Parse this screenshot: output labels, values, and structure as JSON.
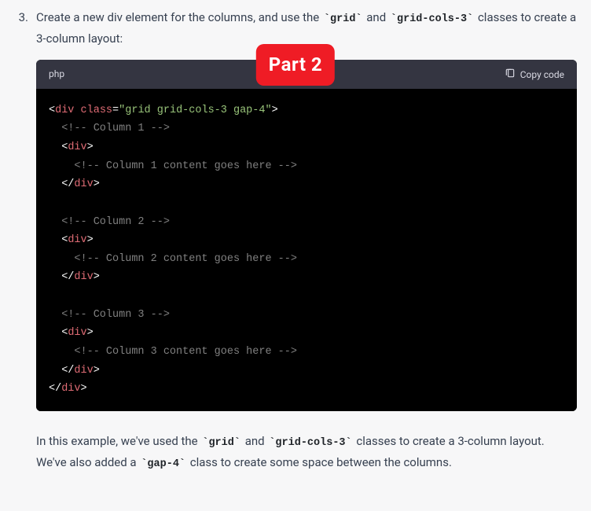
{
  "badge": "Part 2",
  "list": {
    "number": "3.",
    "text_a": "Create a new div element for the columns, and use the ",
    "code_a": "`grid`",
    "text_b": " and ",
    "code_b": "`grid-cols-3`",
    "text_c": " classes to create a 3-column layout:"
  },
  "code": {
    "lang": "php",
    "copy": "Copy code",
    "lines": [
      [
        {
          "cls": "tok-white",
          "t": "<"
        },
        {
          "cls": "tok-red",
          "t": "div"
        },
        {
          "cls": "tok-white",
          "t": " "
        },
        {
          "cls": "tok-red",
          "t": "class"
        },
        {
          "cls": "tok-white",
          "t": "="
        },
        {
          "cls": "tok-green",
          "t": "\"grid grid-cols-3 gap-4\""
        },
        {
          "cls": "tok-white",
          "t": ">"
        }
      ],
      [
        {
          "cls": "tok-white",
          "t": "  "
        },
        {
          "cls": "tok-comment",
          "t": "<!-- Column 1 -->"
        }
      ],
      [
        {
          "cls": "tok-white",
          "t": "  <"
        },
        {
          "cls": "tok-red",
          "t": "div"
        },
        {
          "cls": "tok-white",
          "t": ">"
        }
      ],
      [
        {
          "cls": "tok-white",
          "t": "    "
        },
        {
          "cls": "tok-comment",
          "t": "<!-- Column 1 content goes here -->"
        }
      ],
      [
        {
          "cls": "tok-white",
          "t": "  </"
        },
        {
          "cls": "tok-red",
          "t": "div"
        },
        {
          "cls": "tok-white",
          "t": ">"
        }
      ],
      [],
      [
        {
          "cls": "tok-white",
          "t": "  "
        },
        {
          "cls": "tok-comment",
          "t": "<!-- Column 2 -->"
        }
      ],
      [
        {
          "cls": "tok-white",
          "t": "  <"
        },
        {
          "cls": "tok-red",
          "t": "div"
        },
        {
          "cls": "tok-white",
          "t": ">"
        }
      ],
      [
        {
          "cls": "tok-white",
          "t": "    "
        },
        {
          "cls": "tok-comment",
          "t": "<!-- Column 2 content goes here -->"
        }
      ],
      [
        {
          "cls": "tok-white",
          "t": "  </"
        },
        {
          "cls": "tok-red",
          "t": "div"
        },
        {
          "cls": "tok-white",
          "t": ">"
        }
      ],
      [],
      [
        {
          "cls": "tok-white",
          "t": "  "
        },
        {
          "cls": "tok-comment",
          "t": "<!-- Column 3 -->"
        }
      ],
      [
        {
          "cls": "tok-white",
          "t": "  <"
        },
        {
          "cls": "tok-red",
          "t": "div"
        },
        {
          "cls": "tok-white",
          "t": ">"
        }
      ],
      [
        {
          "cls": "tok-white",
          "t": "    "
        },
        {
          "cls": "tok-comment",
          "t": "<!-- Column 3 content goes here -->"
        }
      ],
      [
        {
          "cls": "tok-white",
          "t": "  </"
        },
        {
          "cls": "tok-red",
          "t": "div"
        },
        {
          "cls": "tok-white",
          "t": ">"
        }
      ],
      [
        {
          "cls": "tok-white",
          "t": "</"
        },
        {
          "cls": "tok-red",
          "t": "div"
        },
        {
          "cls": "tok-white",
          "t": ">"
        }
      ]
    ]
  },
  "paragraph": {
    "a": "In this example, we've used the ",
    "c1": "`grid`",
    "b": " and ",
    "c2": "`grid-cols-3`",
    "c": " classes to create a 3-column layout. We've also added a ",
    "c3": "`gap-4`",
    "d": " class to create some space between the columns."
  }
}
